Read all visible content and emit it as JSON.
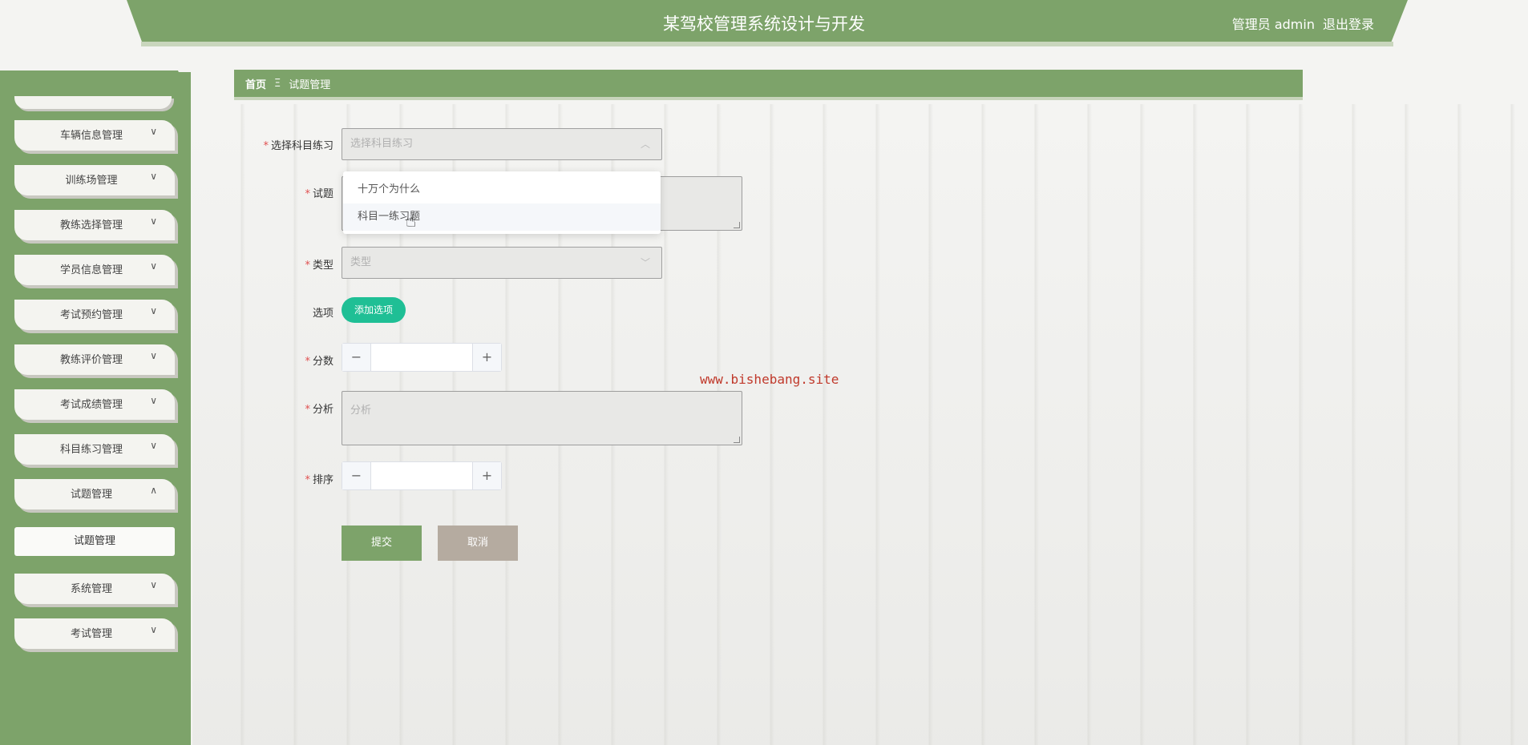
{
  "header": {
    "title": "某驾校管理系统设计与开发",
    "user_label": "管理员 admin",
    "logout_label": "退出登录"
  },
  "sidebar": {
    "items": [
      {
        "label": "车辆信息管理",
        "chevron": "∨"
      },
      {
        "label": "训练场管理",
        "chevron": "∨"
      },
      {
        "label": "教练选择管理",
        "chevron": "∨"
      },
      {
        "label": "学员信息管理",
        "chevron": "∨"
      },
      {
        "label": "考试预约管理",
        "chevron": "∨"
      },
      {
        "label": "教练评价管理",
        "chevron": "∨"
      },
      {
        "label": "考试成绩管理",
        "chevron": "∨"
      },
      {
        "label": "科目练习管理",
        "chevron": "∨"
      },
      {
        "label": "试题管理",
        "chevron": "∧"
      },
      {
        "label": "系统管理",
        "chevron": "∨"
      },
      {
        "label": "考试管理",
        "chevron": "∨"
      }
    ],
    "submenu_active": "试题管理"
  },
  "breadcrumb": {
    "home": "首页",
    "separator": "Ξ",
    "current": "试题管理"
  },
  "form": {
    "subject_label": "选择科目练习",
    "subject_placeholder": "选择科目练习",
    "question_label": "试题",
    "type_label": "类型",
    "type_placeholder": "类型",
    "options_label": "选项",
    "add_option_label": "添加选项",
    "score_label": "分数",
    "analysis_label": "分析",
    "analysis_placeholder": "分析",
    "order_label": "排序",
    "submit_label": "提交",
    "cancel_label": "取消"
  },
  "dropdown": {
    "options": [
      "十万个为什么",
      "科目一练习题"
    ]
  },
  "watermark": "www.bishebang.site",
  "colors": {
    "primary": "#7da36a",
    "accent_button": "#1fbf95",
    "cancel_button": "#b5aba0",
    "required": "#e05050"
  }
}
